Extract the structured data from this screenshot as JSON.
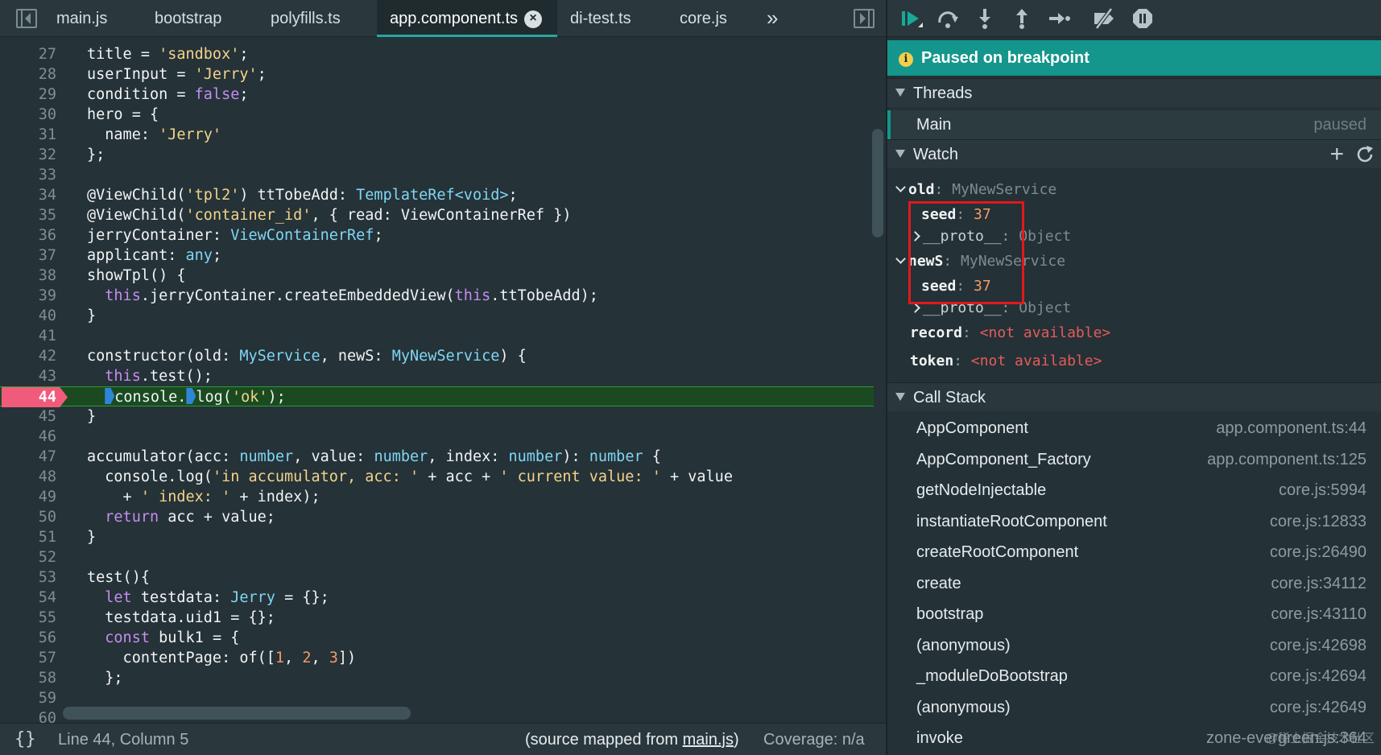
{
  "tabs": [
    {
      "label": "main.js"
    },
    {
      "label": "bootstrap"
    },
    {
      "label": "polyfills.ts"
    },
    {
      "label": "app.component.ts",
      "active": true
    },
    {
      "label": "di-test.ts"
    },
    {
      "label": "core.js"
    }
  ],
  "more_tabs": "»",
  "editor": {
    "current_line": 44,
    "lines": [
      {
        "n": "27",
        "html": "title = <span class=\"s\">'sandbox'</span>;"
      },
      {
        "n": "28",
        "html": "userInput = <span class=\"s\">'Jerry'</span>;"
      },
      {
        "n": "29",
        "html": "condition = <span class=\"k\">false</span>;"
      },
      {
        "n": "30",
        "html": "hero = {"
      },
      {
        "n": "31",
        "html": "  name: <span class=\"s\">'Jerry'</span>"
      },
      {
        "n": "32",
        "html": "};"
      },
      {
        "n": "33",
        "html": ""
      },
      {
        "n": "34",
        "html": "@ViewChild(<span class=\"s\">'tpl2'</span>) ttTobeAdd: <span class=\"t\">TemplateRef&lt;void&gt;</span>;"
      },
      {
        "n": "35",
        "html": "@ViewChild(<span class=\"s\">'container_id'</span>, { read: ViewContainerRef })"
      },
      {
        "n": "36",
        "html": "jerryContainer: <span class=\"t\">ViewContainerRef</span>;"
      },
      {
        "n": "37",
        "html": "applicant: <span class=\"t\">any</span>;"
      },
      {
        "n": "38",
        "html": "showTpl() {"
      },
      {
        "n": "39",
        "html": "  <span class=\"k\">this</span>.jerryContainer.createEmbeddedView(<span class=\"k\">this</span>.ttTobeAdd);"
      },
      {
        "n": "40",
        "html": "}"
      },
      {
        "n": "41",
        "html": ""
      },
      {
        "n": "42",
        "html": "constructor(old: <span class=\"t\">MyService</span>, newS: <span class=\"t\">MyNewService</span>) {"
      },
      {
        "n": "43",
        "html": "  <span class=\"k\">this</span>.test();"
      },
      {
        "n": "44",
        "html": "  <span class=\"step-mark\"></span>console.<span class=\"step-mark\"></span>log(<span class=\"s\">'ok'</span>);"
      },
      {
        "n": "45",
        "html": "}"
      },
      {
        "n": "46",
        "html": ""
      },
      {
        "n": "47",
        "html": "accumulator(acc: <span class=\"t\">number</span>, value: <span class=\"t\">number</span>, index: <span class=\"t\">number</span>): <span class=\"t\">number</span> {"
      },
      {
        "n": "48",
        "html": "  console.log(<span class=\"s\">'in accumulator, acc: '</span> + acc + <span class=\"s\">' current value: '</span> + value"
      },
      {
        "n": "49",
        "html": "    + <span class=\"s\">' index: '</span> + index);"
      },
      {
        "n": "50",
        "html": "  <span class=\"k\">return</span> acc + value;"
      },
      {
        "n": "51",
        "html": "}"
      },
      {
        "n": "52",
        "html": ""
      },
      {
        "n": "53",
        "html": "test(){"
      },
      {
        "n": "54",
        "html": "  <span class=\"k\">let</span> testdata: <span class=\"t\">Jerry</span> = {};"
      },
      {
        "n": "55",
        "html": "  testdata.uid1 = {};"
      },
      {
        "n": "56",
        "html": "  <span class=\"k\">const</span> bulk1 = {"
      },
      {
        "n": "57",
        "html": "    contentPage: of([<span class=\"n\">1</span>, <span class=\"n\">2</span>, <span class=\"n\">3</span>])"
      },
      {
        "n": "58",
        "html": "  };"
      },
      {
        "n": "59",
        "html": ""
      },
      {
        "n": "60",
        "html": ""
      }
    ]
  },
  "status": {
    "pretty_print": "{}",
    "cursor": "Line 44, Column 5",
    "source_mapped_prefix": "(source mapped from ",
    "source_mapped_file": "main.js",
    "source_mapped_suffix": ")",
    "coverage": "Coverage: n/a"
  },
  "debugger": {
    "paused_message": "Paused on breakpoint",
    "threads_title": "Threads",
    "thread_name": "Main",
    "thread_status": "paused",
    "watch_title": "Watch",
    "watch": [
      {
        "kind": "open",
        "key": "old",
        "type": "MyNewService"
      },
      {
        "kind": "child",
        "key": "seed",
        "num": "37"
      },
      {
        "kind": "proto",
        "key": "__proto__",
        "type": "Object"
      },
      {
        "kind": "open",
        "key": "newS",
        "type": "MyNewService"
      },
      {
        "kind": "child",
        "key": "seed",
        "num": "37"
      },
      {
        "kind": "proto",
        "key": "__proto__",
        "type": "Object"
      },
      {
        "kind": "na",
        "key": "record",
        "na": "<not available>"
      },
      {
        "kind": "na",
        "key": "token",
        "na": "<not available>"
      }
    ],
    "callstack_title": "Call Stack",
    "frames": [
      {
        "name": "AppComponent",
        "loc": "app.component.ts:44"
      },
      {
        "name": "AppComponent_Factory",
        "loc": "app.component.ts:125"
      },
      {
        "name": "getNodeInjectable",
        "loc": "core.js:5994"
      },
      {
        "name": "instantiateRootComponent",
        "loc": "core.js:12833"
      },
      {
        "name": "createRootComponent",
        "loc": "core.js:26490"
      },
      {
        "name": "create",
        "loc": "core.js:34112"
      },
      {
        "name": "bootstrap",
        "loc": "core.js:43110"
      },
      {
        "name": "(anonymous)",
        "loc": "core.js:42698"
      },
      {
        "name": "_moduleDoBootstrap",
        "loc": "core.js:42694"
      },
      {
        "name": "(anonymous)",
        "loc": "core.js:42649"
      },
      {
        "name": "invoke",
        "loc": "zone-evergreen.js:364"
      }
    ],
    "watermark": "@稀土掘金技术社区"
  },
  "colors": {
    "accent": "#14968c",
    "breakpoint": "#f15b7b",
    "current_line": "#1b4a21",
    "highlight_box": "#e0191c"
  },
  "icons": [
    "sidebar-toggle-icon",
    "close-icon",
    "resume-icon",
    "step-over-icon",
    "step-in-icon",
    "step-out-icon",
    "step-icon",
    "deactivate-breakpoints-icon",
    "pause-on-exceptions-icon",
    "info-icon",
    "add-icon",
    "refresh-icon"
  ]
}
